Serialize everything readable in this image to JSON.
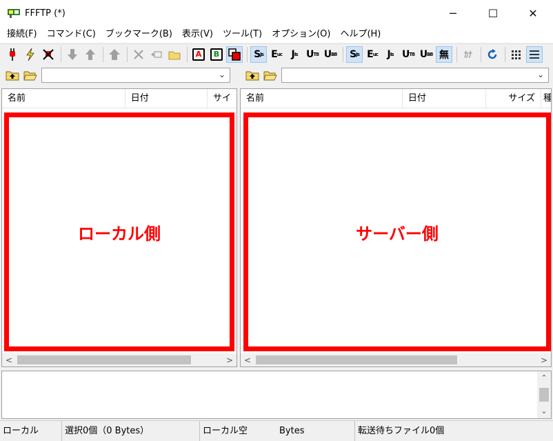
{
  "window": {
    "title": "FFFTP (*)",
    "minimize": "─",
    "maximize": "☐",
    "close": "✕"
  },
  "menu": [
    "接続(F)",
    "コマンド(C)",
    "ブックマーク(B)",
    "表示(V)",
    "ツール(T)",
    "オプション(O)",
    "ヘルプ(H)"
  ],
  "toolbar": {
    "ascii_mode": "A",
    "binary_mode": "B",
    "kanji_sjis": "S",
    "kanji_euc": "E",
    "kanji_jis": "J",
    "kanji_utf8": "U",
    "kanji_utf8bom": "U",
    "muhenkan": "無",
    "kana": "ｶﾅ"
  },
  "local_pane": {
    "headers": [
      "名前",
      "日付",
      "サイ"
    ],
    "overlay_label": "ローカル側"
  },
  "remote_pane": {
    "headers": [
      "名前",
      "日付",
      "サイズ",
      "種"
    ],
    "overlay_label": "サーバー側"
  },
  "status": {
    "location": "ローカル",
    "selection": "選択0個（0 Bytes）",
    "free_label": "ローカル空",
    "free_unit": "Bytes",
    "queue": "転送待ちファイル0個"
  },
  "colors": {
    "highlight_red": "#ff0000",
    "active_toolbar": "#cfe3f7"
  }
}
